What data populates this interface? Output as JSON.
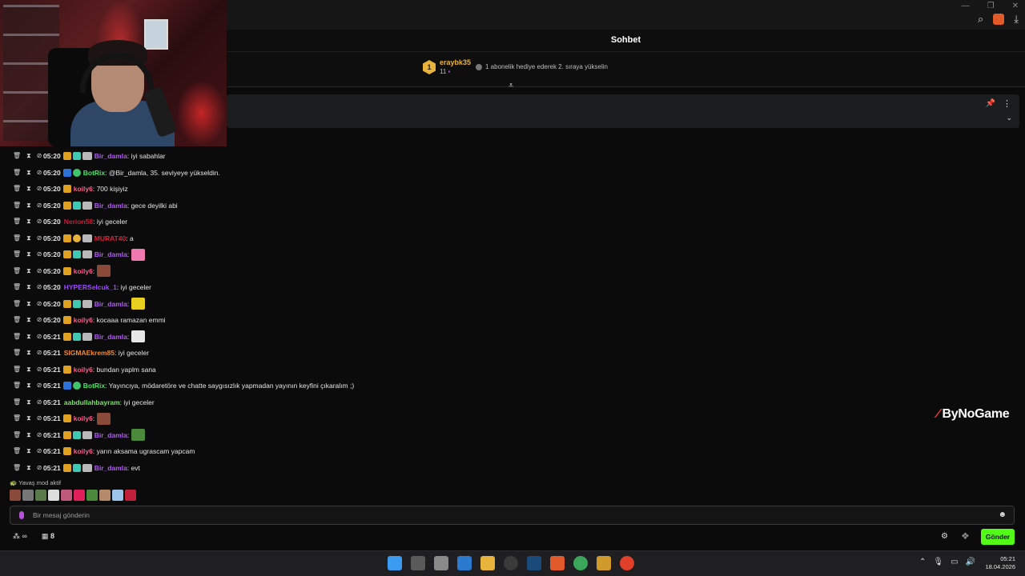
{
  "header": {
    "title": "Sohbet"
  },
  "leaderboard": {
    "rank": "1",
    "username": "eraybk35",
    "count": "11",
    "info": "1 abonelik hediye ederek 2. sıraya yükselin"
  },
  "chat": {
    "messages": [
      {
        "time": "05:20",
        "badges": [
          "crown",
          "green",
          "hat"
        ],
        "user": "Bir_damla",
        "color": "#b05cf0",
        "text": ": iyi sabahlar"
      },
      {
        "time": "05:20",
        "badges": [
          "blue",
          "check"
        ],
        "user": "BotRix",
        "color": "#4ce36b",
        "text": ": @Bir_damla, 35. seviyeye yükseldin."
      },
      {
        "time": "05:20",
        "badges": [
          "crown"
        ],
        "user": "koily6",
        "color": "#ff5c8a",
        "text": ": 700 kişiyiz"
      },
      {
        "time": "05:20",
        "badges": [
          "crown",
          "green",
          "hat"
        ],
        "user": "Bir_damla",
        "color": "#b05cf0",
        "text": ": gece deyilki abi"
      },
      {
        "time": "05:20",
        "badges": [],
        "user": "Nerion58",
        "color": "#c0203a",
        "text": ": iyi geceler"
      },
      {
        "time": "05:20",
        "badges": [
          "crown",
          "coin",
          "hat"
        ],
        "user": "MURAT40",
        "color": "#e0203a",
        "text": ": a"
      },
      {
        "time": "05:20",
        "badges": [
          "crown",
          "green",
          "hat"
        ],
        "user": "Bir_damla",
        "color": "#b05cf0",
        "text": ":",
        "emote": "#f07ab0"
      },
      {
        "time": "05:20",
        "badges": [
          "crown"
        ],
        "user": "koily6",
        "color": "#ff5c8a",
        "text": ":",
        "emote": "#8a4a3a"
      },
      {
        "time": "05:20",
        "badges": [],
        "user": "HYPERSelcuk_1",
        "color": "#9a4cf5",
        "text": ": iyi geceler"
      },
      {
        "time": "05:20",
        "badges": [
          "crown",
          "green",
          "hat"
        ],
        "user": "Bir_damla",
        "color": "#b05cf0",
        "text": ":",
        "emote": "#e8d020"
      },
      {
        "time": "05:20",
        "badges": [
          "crown"
        ],
        "user": "koily6",
        "color": "#ff5c8a",
        "text": ": kocaaa ramazan emmi"
      },
      {
        "time": "05:21",
        "badges": [
          "crown",
          "green",
          "hat"
        ],
        "user": "Bir_damla",
        "color": "#b05cf0",
        "text": ":",
        "emote": "#e6e6e6"
      },
      {
        "time": "05:21",
        "badges": [],
        "user": "SIGMAEkrem85",
        "color": "#f08a2a",
        "text": ": iyi geceler"
      },
      {
        "time": "05:21",
        "badges": [
          "crown"
        ],
        "user": "koily6",
        "color": "#ff5c8a",
        "text": ": bundan yaplm sana"
      },
      {
        "time": "05:21",
        "badges": [
          "blue",
          "check"
        ],
        "user": "BotRix",
        "color": "#4ce36b",
        "text": ": Yayıncıya, mödaretöre ve chatte saygısızlık yapmadan yayının keyfini çıkaralım ;)"
      },
      {
        "time": "05:21",
        "badges": [],
        "user": "aabdullahbayram",
        "color": "#7ee06a",
        "text": ": iyi geceler"
      },
      {
        "time": "05:21",
        "badges": [
          "crown"
        ],
        "user": "koily6",
        "color": "#ff5c8a",
        "text": ":",
        "emote": "#8a4a3a"
      },
      {
        "time": "05:21",
        "badges": [
          "crown",
          "green",
          "hat"
        ],
        "user": "Bir_damla",
        "color": "#b05cf0",
        "text": ":",
        "emote": "#4a8a3a"
      },
      {
        "time": "05:21",
        "badges": [
          "crown"
        ],
        "user": "koily6",
        "color": "#ff5c8a",
        "text": ": yarın aksama ugrascam yapcam"
      },
      {
        "time": "05:21",
        "badges": [
          "crown",
          "green",
          "hat"
        ],
        "user": "Bir_damla",
        "color": "#b05cf0",
        "text": ": evt"
      }
    ]
  },
  "slow_mode": "Yavaş mod aktif",
  "input": {
    "placeholder": "Bir mesaj gönderin"
  },
  "footer": {
    "count": "8",
    "send_label": "Gönder"
  },
  "watermark": "ByNoGame",
  "taskbar": {
    "time": "05:21",
    "date": "18.04.2026"
  },
  "colors": {
    "accent": "#53fc18",
    "background": "#0b0b0c"
  }
}
